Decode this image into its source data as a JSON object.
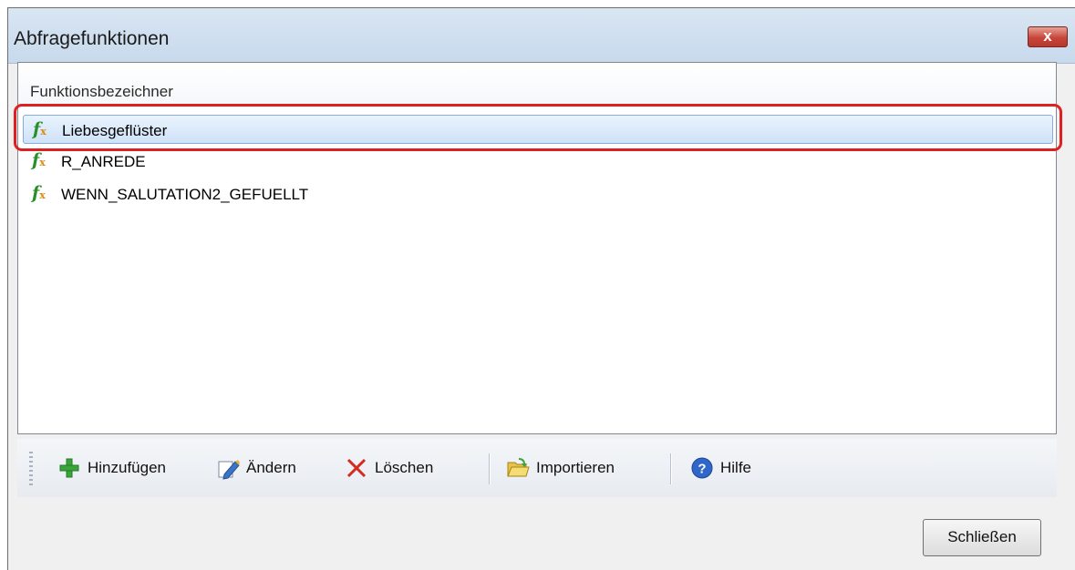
{
  "window": {
    "title": "Abfragefunktionen",
    "close_glyph": "x"
  },
  "list": {
    "header": "Funktionsbezeichner",
    "items": [
      {
        "label": "Liebesgeflüster",
        "icon": "function-icon",
        "selected": true
      },
      {
        "label": "R_ANREDE",
        "icon": "function-icon"
      },
      {
        "label": "WENN_SALUTATION2_GEFUELLT",
        "icon": "function-icon"
      }
    ]
  },
  "toolbar": {
    "add_label": "Hinzufügen",
    "edit_label": "Ändern",
    "delete_label": "Löschen",
    "import_label": "Importieren",
    "help_label": "Hilfe"
  },
  "footer": {
    "close_label": "Schließen"
  },
  "colors": {
    "highlight": "#e02020",
    "function_icon": "#2a8f24"
  }
}
